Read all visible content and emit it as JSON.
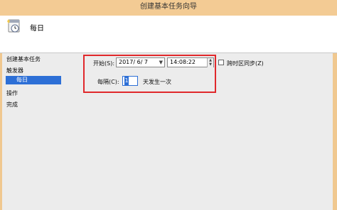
{
  "window": {
    "title": "创建基本任务向导"
  },
  "header": {
    "title": "每日",
    "icon": "clock-icon"
  },
  "sidebar": {
    "items": [
      {
        "label": "创建基本任务",
        "selected": false
      },
      {
        "label": "触发器",
        "selected": false
      },
      {
        "label": "每日",
        "selected": true
      },
      {
        "label": "操作",
        "selected": false
      },
      {
        "label": "完成",
        "selected": false
      }
    ],
    "selected_color": "#2d6fd6"
  },
  "form": {
    "start_label": "开始(S):",
    "start_date": "2017/ 6/ 7",
    "start_time": "14:08:22",
    "sync_tz_label": "跨时区同步(Z)",
    "sync_tz_checked": false,
    "every_label": "每隔(C):",
    "every_value": "1",
    "every_suffix": "天发生一次"
  },
  "colors": {
    "highlight_box": "#e0282b",
    "frame": "#f0c890"
  }
}
